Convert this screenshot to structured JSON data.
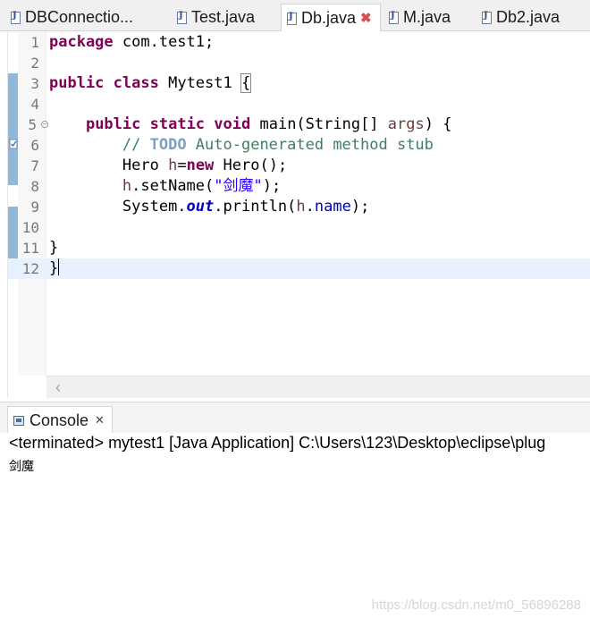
{
  "editor_tabs": [
    {
      "label": "DBConnectio...",
      "icon": "java-file-icon"
    },
    {
      "label": "Test.java",
      "icon": "java-file-icon"
    },
    {
      "label": "Db.java",
      "icon": "java-file-icon",
      "active": true
    },
    {
      "label": "M.java",
      "icon": "java-file-icon"
    },
    {
      "label": "Db2.java",
      "icon": "java-file-icon"
    }
  ],
  "editor": {
    "line_numbers": [
      "1",
      "2",
      "3",
      "4",
      "5",
      "6",
      "7",
      "8",
      "9",
      "10",
      "11",
      "12"
    ],
    "code": {
      "l1_kw": "package",
      "l1_rest": " com.test1;",
      "l3_kw1": "public",
      "l3_kw2": "class",
      "l3_name": " Mytest1 ",
      "l3_brace": "{",
      "l5_kw1": "public",
      "l5_kw2": "static",
      "l5_kw3": "void",
      "l5_main": " main(String[] ",
      "l5_args": "args",
      "l5_end": ") {",
      "l6_comment_start": "// ",
      "l6_todo": "TODO",
      "l6_comment_rest": " Auto-generated method stub",
      "l7_type": "Hero ",
      "l7_var": "h",
      "l7_eq": "=",
      "l7_kw": "new",
      "l7_rest": " Hero();",
      "l8_var": "h",
      "l8_call": ".setName(",
      "l8_str": "\"剑魔\"",
      "l8_end": ");",
      "l9_sys": "System.",
      "l9_out": "out",
      "l9_println": ".println(",
      "l9_var": "h",
      "l9_dot": ".",
      "l9_field": "name",
      "l9_end": ");",
      "l11": "}",
      "l12": "}"
    }
  },
  "console": {
    "tab_label": "Console",
    "status": "<terminated> mytest1 [Java Application] C:\\Users\\123\\Desktop\\eclipse\\plug",
    "output": "剑魔"
  },
  "watermark": "https://blog.csdn.net/m0_56896288",
  "colors": {
    "keyword": "#7f0055",
    "comment": "#3f7f5f",
    "string": "#2a00ff",
    "field": "#0000c0",
    "current_line": "#e8f2fe",
    "change_bar": "#8fb8da"
  }
}
